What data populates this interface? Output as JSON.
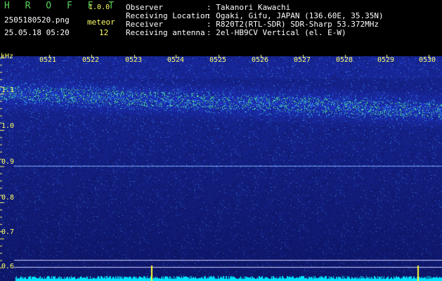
{
  "header": {
    "app_name": "H R O F F T",
    "version": "1.0.0",
    "filename": "2505180520.png",
    "datetime": "25.05.18 05:20",
    "meteor_label": "meteor",
    "meteor_count": "12",
    "info_labels": [
      "Observer",
      "Receiving Location",
      "Receiver",
      "Receiving antenna"
    ],
    "info_values": [
      ": Takanori Kawachi",
      ": Ogaki, Gifu, JAPAN (136.60E, 35.35N)",
      ": R820T2(RTL-SDR) SDR-Sharp 53.372MHz",
      ": 2el-HB9CV Vertical (el. E-W)"
    ]
  },
  "spectrogram": {
    "unit_label": "kHz",
    "time_ticks": [
      "0521",
      "0522",
      "0523",
      "0524",
      "0525",
      "0526",
      "0527",
      "0528",
      "0529",
      "0530"
    ],
    "freq_ticks": [
      "1.1",
      "1.0",
      "0.9",
      "0.8",
      "0.7",
      "0.6"
    ],
    "colors": {
      "background": "#0a0a6e",
      "signal": "#4a7cff",
      "peak": "#7dff7d",
      "label": "#ffff66",
      "baseline": "#00e5ff"
    }
  }
}
